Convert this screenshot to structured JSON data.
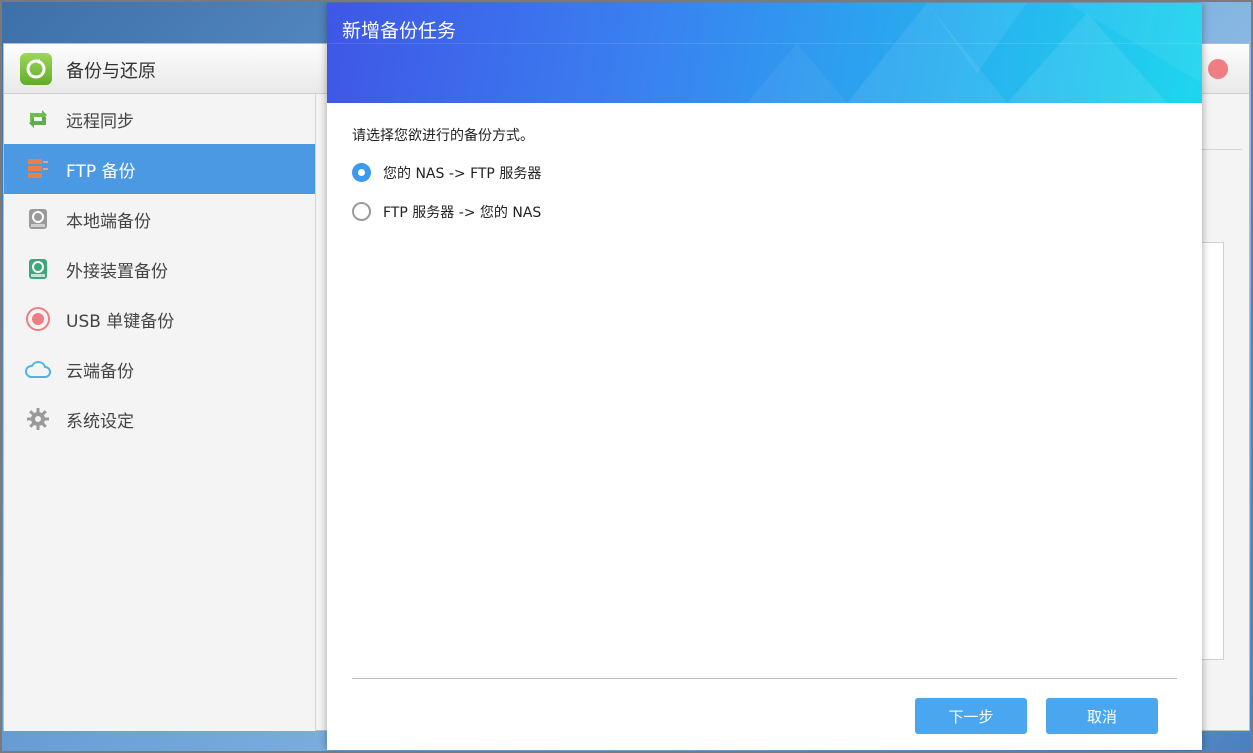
{
  "app": {
    "title": "备份与还原",
    "colors": {
      "accent": "#4b99e3",
      "close": "#f07c84"
    }
  },
  "sidebar": {
    "items": [
      {
        "label": "远程同步",
        "icon": "sync-icon",
        "active": false
      },
      {
        "label": "FTP 备份",
        "icon": "ftp-server-icon",
        "active": true
      },
      {
        "label": "本地端备份",
        "icon": "local-disk-icon",
        "active": false
      },
      {
        "label": "外接装置备份",
        "icon": "external-disk-icon",
        "active": false
      },
      {
        "label": "USB 单键备份",
        "icon": "usb-button-icon",
        "active": false
      },
      {
        "label": "云端备份",
        "icon": "cloud-icon",
        "active": false
      },
      {
        "label": "系统设定",
        "icon": "gear-icon",
        "active": false
      }
    ]
  },
  "dialog": {
    "title": "新增备份任务",
    "prompt": "请选择您欲进行的备份方式。",
    "options": [
      {
        "label": "您的 NAS -> FTP 服务器",
        "checked": true
      },
      {
        "label": "FTP 服务器 -> 您的 NAS",
        "checked": false
      }
    ],
    "buttons": {
      "next": "下一步",
      "cancel": "取消"
    }
  }
}
